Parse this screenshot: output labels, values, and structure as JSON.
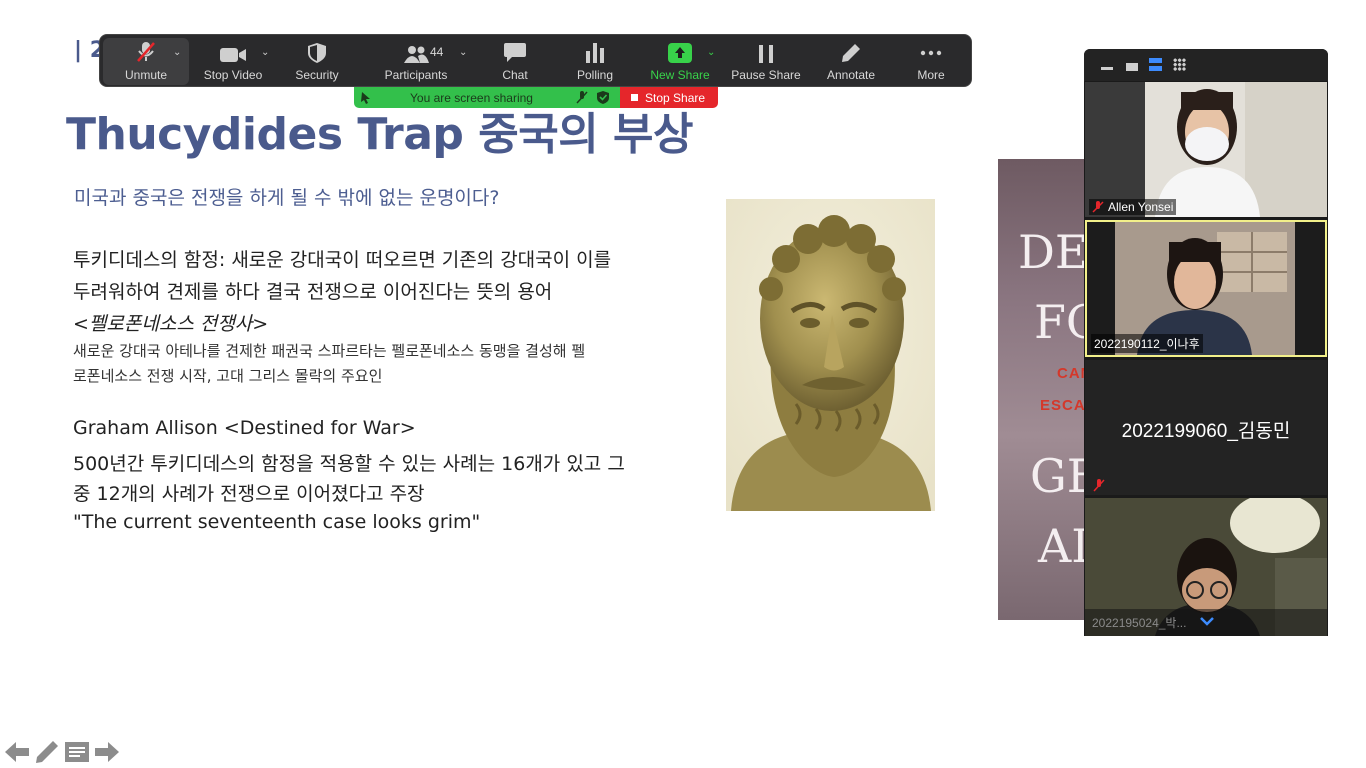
{
  "slide": {
    "number": "| 2",
    "title": "Thucydides Trap 중국의 부상",
    "subtitle": "미국과 중국은 전쟁을 하게 될 수 밖에 없는 운명이다?",
    "para1_line1": "투키디데스의 함정: 새로운 강대국이 떠오르면 기존의 강대국이 이를",
    "para1_line2": "두려워하여 견제를 하다 결국 전쟁으로 이어진다는 뜻의 용어",
    "para1_italic": "<펠로폰네소스 전쟁사>",
    "para1_small1": "새로운 강대국 아테나를 견제한 패권국 스파르타는 펠로폰네소스 동맹을 결성해 펠",
    "para1_small2": "로폰네소스 전쟁 시작, 고대 그리스 몰락의 주요인",
    "para2_line1": "Graham Allison <Destined for War>",
    "para2_line2": "500년간 투키디데스의 함정을 적용할 수 있는 사례는 16개가 있고 그",
    "para2_line3": "중 12개의 사례가 전쟁으로 이어졌다고 주장",
    "para2_quote": "\"The current seventeenth case looks grim\""
  },
  "book_cover": {
    "line1": "DE",
    "line2": "FO",
    "red1": "CAN",
    "red2": "ESCAP",
    "line3": "GE",
    "line4": "AL"
  },
  "toolbar": {
    "unmute": "Unmute",
    "stop_video": "Stop Video",
    "security": "Security",
    "participants": "Participants",
    "participant_count": "44",
    "chat": "Chat",
    "polling": "Polling",
    "new_share": "New Share",
    "pause_share": "Pause Share",
    "annotate": "Annotate",
    "more": "More"
  },
  "share_banner": {
    "status": "You are screen sharing",
    "stop": "Stop Share"
  },
  "participants_panel": {
    "tiles": [
      {
        "name": "Allen Yonsei"
      },
      {
        "name": "2022190112_이나후"
      },
      {
        "name": "2022199060_김동민"
      },
      {
        "name": "2022195024_박..."
      }
    ]
  },
  "colors": {
    "title_blue": "#4a5a8c",
    "toolbar_bg": "#2a2a2c",
    "share_green": "#33c04b",
    "stop_red": "#e5262b",
    "active_border": "#f2f08a"
  }
}
